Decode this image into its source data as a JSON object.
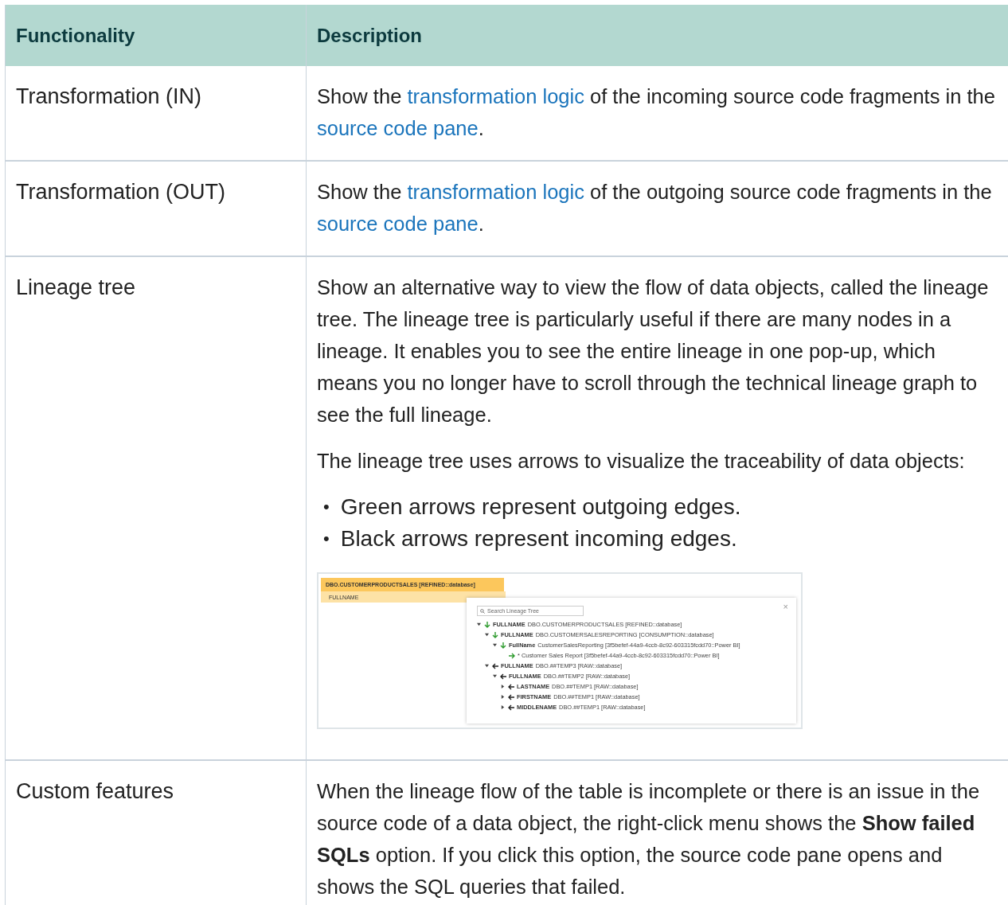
{
  "table": {
    "columns": [
      "Functionality",
      "Description"
    ],
    "rows": [
      {
        "functionality": "Transformation (IN)",
        "description": [
          {
            "kind": "paragraph",
            "segments": [
              {
                "text": "Show the "
              },
              {
                "text": "transformation logic",
                "link": true
              },
              {
                "text": " of the incoming source code fragments in the "
              },
              {
                "text": "source code pane",
                "link": true
              },
              {
                "text": "."
              }
            ]
          }
        ]
      },
      {
        "functionality": "Transformation (OUT)",
        "description": [
          {
            "kind": "paragraph",
            "segments": [
              {
                "text": "Show the "
              },
              {
                "text": "transformation logic",
                "link": true
              },
              {
                "text": " of the outgoing source code fragments in the "
              },
              {
                "text": "source code pane",
                "link": true
              },
              {
                "text": "."
              }
            ]
          }
        ]
      },
      {
        "functionality": "Lineage tree",
        "description": [
          {
            "kind": "paragraph",
            "segments": [
              {
                "text": "Show an alternative way to view the flow of data objects, called the lineage tree. The lineage tree is particularly useful if there are many nodes in a lineage. It enables you to see the entire lineage in one pop-up, which means you no longer have to scroll through the technical lineage graph to see the full lineage."
              }
            ]
          },
          {
            "kind": "paragraph",
            "segments": [
              {
                "text": "The lineage tree uses arrows to visualize the traceability of data objects:"
              }
            ]
          },
          {
            "kind": "bullets",
            "items": [
              {
                "marker": "•",
                "text": "Green arrows represent outgoing edges."
              },
              {
                "marker": "•",
                "text": "Black arrows represent incoming edges."
              }
            ]
          },
          {
            "kind": "figure",
            "object_title": "DBO.CUSTOMERPRODUCTSALES [REFINED::database]",
            "object_field": "FULLNAME",
            "search": {
              "placeholder": "Search Lineage Tree"
            },
            "close": "×",
            "tree": [
              {
                "kind": "branch",
                "expanded": true,
                "outgoing": true,
                "name": "FULLNAME",
                "detail": "DBO.CUSTOMERPRODUCTSALES [REFINED::database]",
                "children": [
                  {
                    "kind": "branch",
                    "expanded": true,
                    "outgoing": true,
                    "name": "FULLNAME",
                    "detail": "DBO.CUSTOMERSALESREPORTING [CONSUMPTION::database]",
                    "children": [
                      {
                        "kind": "branch",
                        "expanded": true,
                        "outgoing": true,
                        "name": "FullName",
                        "detail": "CustomerSalesReporting [3f5befef-44a9-4ccb-8c92-603315fcdd70::Power BI]",
                        "children": [
                          {
                            "kind": "leaf",
                            "outgoing": true,
                            "detail": "* Customer Sales Report [3f5befef-44a9-4ccb-8c92-603315fcdd70::Power BI]"
                          }
                        ]
                      }
                    ]
                  },
                  {
                    "kind": "branch",
                    "expanded": true,
                    "outgoing": false,
                    "name": "FULLNAME",
                    "detail": "DBO.##TEMP3 [RAW::database]",
                    "children": [
                      {
                        "kind": "branch",
                        "expanded": true,
                        "outgoing": false,
                        "name": "FULLNAME",
                        "detail": "DBO.##TEMP2 [RAW::database]",
                        "children": [
                          {
                            "kind": "branch",
                            "expanded": false,
                            "outgoing": false,
                            "name": "LASTNAME",
                            "detail": "DBO.##TEMP1 [RAW::database]"
                          },
                          {
                            "kind": "branch",
                            "expanded": false,
                            "outgoing": false,
                            "name": "FIRSTNAME",
                            "detail": "DBO.##TEMP1 [RAW::database]"
                          },
                          {
                            "kind": "branch",
                            "expanded": false,
                            "outgoing": false,
                            "name": "MIDDLENAME",
                            "detail": "DBO.##TEMP1 [RAW::database]"
                          }
                        ]
                      }
                    ]
                  }
                ]
              }
            ]
          }
        ]
      },
      {
        "functionality": "Custom features",
        "description": [
          {
            "kind": "paragraph",
            "segments": [
              {
                "text": "When the lineage flow of the table is incomplete or there is an issue in the source code of a data object, the right-click menu shows the **Show failed SQLs** option. If you click this option, the source code pane opens and shows the SQL queries that failed."
              }
            ]
          }
        ]
      }
    ]
  }
}
